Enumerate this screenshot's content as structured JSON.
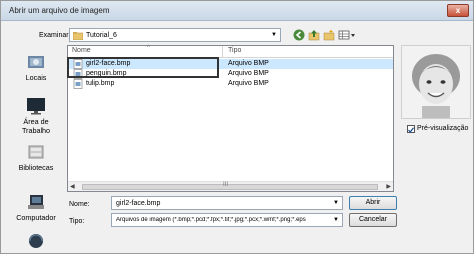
{
  "window": {
    "title": "Abrir um arquivo de imagem",
    "close_glyph": "x"
  },
  "lookin": {
    "label": "Examinar:",
    "value": "Tutorial_6",
    "icon": "folder-icon"
  },
  "toolbar": {
    "icons": [
      "back-icon",
      "up-folder-icon",
      "new-folder-icon",
      "view-menu-icon"
    ]
  },
  "places": [
    {
      "label": "Locais",
      "icon": "recent-places-icon"
    },
    {
      "label": "Área de\nTrabalho",
      "icon": "desktop-icon"
    },
    {
      "label": "Bibliotecas",
      "icon": "libraries-icon"
    },
    {
      "label": "Computador",
      "icon": "computer-icon"
    },
    {
      "label": "",
      "icon": "network-icon"
    }
  ],
  "filelist": {
    "columns": {
      "name": "Nome",
      "type": "Tipo"
    },
    "rows": [
      {
        "name": "girl2-face.bmp",
        "type": "Arquivo BMP",
        "selected": true
      },
      {
        "name": "penguin.bmp",
        "type": "Arquivo BMP",
        "selected": false
      },
      {
        "name": "tulip.bmp",
        "type": "Arquivo BMP",
        "selected": false
      }
    ]
  },
  "form": {
    "name_label": "Nome:",
    "name_value": "girl2-face.bmp",
    "type_label": "Tipo:",
    "type_value": "Arquivos de imagem (*.bmp;*.pcd;*.fpx;*.tif;*.jpg;*.pcx;*.wmf;*.png;*.eps"
  },
  "buttons": {
    "open": "Abrir",
    "cancel": "Cancelar"
  },
  "preview": {
    "checkbox_label": "Pré-visualização",
    "checked": true
  },
  "colors": {
    "selection": "#cce8ff",
    "title_gradient_top": "#dfe8f2"
  }
}
